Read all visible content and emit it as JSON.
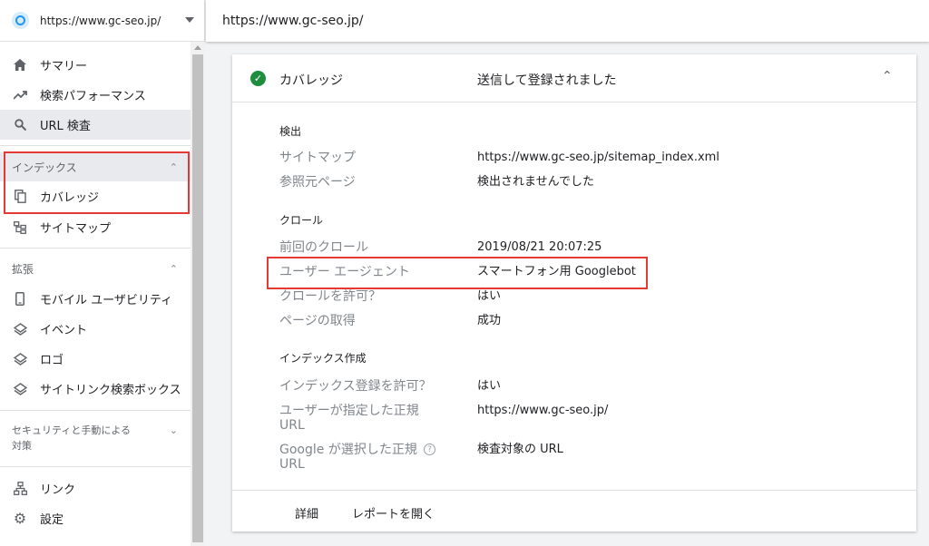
{
  "property": {
    "url": "https://www.gc-seo.jp/",
    "icon": "globe-icon"
  },
  "header": {
    "url": "https://www.gc-seo.jp/"
  },
  "sidebar": {
    "items": [
      {
        "label": "サマリー",
        "icon": "home-icon"
      },
      {
        "label": "検索パフォーマンス",
        "icon": "trending-up-icon"
      },
      {
        "label": "URL 検査",
        "icon": "search-icon"
      }
    ],
    "index_section": {
      "title": "インデックス",
      "items": [
        {
          "label": "カバレッジ",
          "icon": "copy-icon"
        },
        {
          "label": "サイトマップ",
          "icon": "sitemap-icon"
        }
      ]
    },
    "enhancements_section": {
      "title": "拡張",
      "items": [
        {
          "label": "モバイル ユーザビリティ",
          "icon": "phone-icon"
        },
        {
          "label": "イベント",
          "icon": "layers-icon"
        },
        {
          "label": "ロゴ",
          "icon": "layers-icon"
        },
        {
          "label": "サイトリンク検索ボックス",
          "icon": "layers-icon"
        }
      ]
    },
    "security_section": {
      "title_line1": "セキュリティと手動による",
      "title_line2": "対策"
    },
    "bottom_items": [
      {
        "label": "リンク",
        "icon": "network-icon"
      },
      {
        "label": "設定",
        "icon": "gear-icon"
      }
    ]
  },
  "card": {
    "title": "カバレッジ",
    "status": "送信して登録されました",
    "discovery": {
      "heading": "検出",
      "rows": [
        {
          "label": "サイトマップ",
          "value": "https://www.gc-seo.jp/sitemap_index.xml"
        },
        {
          "label": "参照元ページ",
          "value": "検出されませんでした"
        }
      ]
    },
    "crawl": {
      "heading": "クロール",
      "rows": [
        {
          "label": "前回のクロール",
          "value": "2019/08/21 20:07:25"
        },
        {
          "label": "ユーザー エージェント",
          "value": "スマートフォン用 Googlebot"
        },
        {
          "label": "クロールを許可？",
          "value": "はい"
        },
        {
          "label": "ページの取得",
          "value": "成功"
        }
      ]
    },
    "indexing": {
      "heading": "インデックス作成",
      "rows": [
        {
          "label": "インデックス登録を許可？",
          "value": "はい"
        },
        {
          "label_line1": "ユーザーが指定した正規",
          "label_line2": "URL",
          "value": "https://www.gc-seo.jp/"
        },
        {
          "label_line1": "Google が選択した正規",
          "label_line2": "URL",
          "value": "検査対象の URL"
        }
      ]
    },
    "footer": {
      "details": "詳細",
      "open_report": "レポートを開く"
    }
  },
  "colors": {
    "success": "#1e8e3e",
    "highlight": "#e53935",
    "active_bg": "#e8eaed"
  }
}
